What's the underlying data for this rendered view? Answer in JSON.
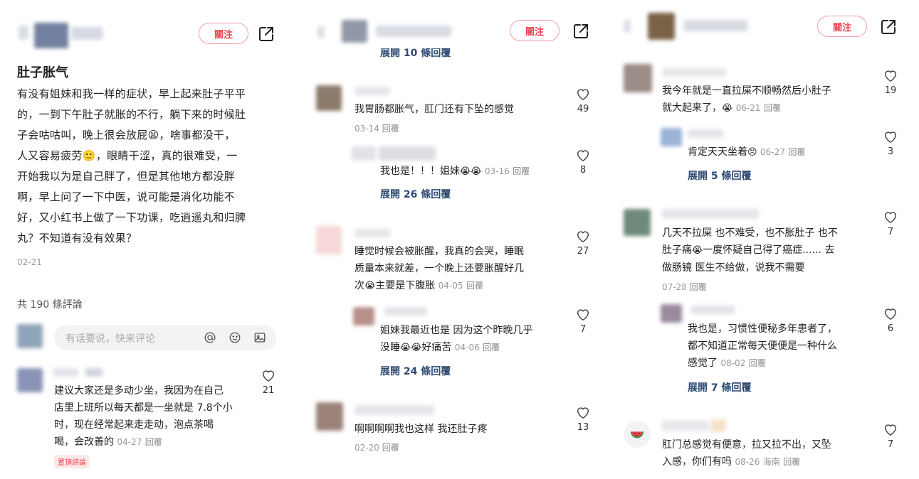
{
  "panel1": {
    "follow_label": "關注",
    "post_title": "肚子胀气",
    "post_lines": [
      "有没有姐妹和我一样的症状，早上起来肚子平平",
      "的，一到下午肚子就胀的不行，躺下来的时候肚",
      "子会咕咕叫，晚上很会放屁😫，啥事都没干，",
      "人又容易疲劳🙂，眼睛干涩，真的很难受，一",
      "开始我以为是自己胖了，但是其他地方都没胖",
      "啊，早上问了一下中医，说可能是消化功能不",
      "好，又小红书上做了一下功课，吃逍遥丸和归脾",
      "丸？不知道有没有效果？"
    ],
    "post_date": "02-21",
    "comment_count": "共 190 條評論",
    "input_placeholder": "有话要说，快来评论",
    "comment1": {
      "lines": [
        "建议大家还是多动少坐，我因为在自己",
        "店里上班所以每天都是一坐就是 7.8个小",
        "时，现在经常起来走走动，泡点茶喝"
      ],
      "last_line": "喝，会改善的",
      "date": "04-27",
      "reply": "回覆",
      "likes": "21",
      "pinned_label": "置頂評論"
    }
  },
  "panel2": {
    "follow_label": "關注",
    "top_cut": "展開 10 條回覆",
    "c1": {
      "text": "我胃肠都胀气，肛门还有下坠的感觉",
      "date": "03-14",
      "reply": "回覆",
      "likes": "49"
    },
    "r1": {
      "text": "我也是！！！姐妹",
      "emoji": "😭😭",
      "date": "03-16",
      "reply": "回覆",
      "likes": "8"
    },
    "expand1": "展開 26 條回覆",
    "c2": {
      "lines": [
        "睡觉时候会被胀醒，我真的会哭，睡眠",
        "质量本来就差，一个晚上还要胀醒好几"
      ],
      "last_prefix": "次",
      "emoji": "😭",
      "last_suffix": "主要是下腹胀",
      "date": "04-05",
      "reply": "回覆",
      "likes": "27"
    },
    "r2": {
      "line1": "姐妹我最近也是 因为这个昨晚几乎",
      "line2_prefix": "没睡",
      "emoji": "😭😭",
      "line2_suffix": "好痛苦",
      "date": "04-06",
      "reply": "回覆",
      "likes": "7"
    },
    "expand2": "展開 24 條回覆",
    "c3": {
      "text": "啊啊啊啊我也这样 我还肚子疼",
      "date": "02-20",
      "reply": "回覆",
      "likes": "13"
    }
  },
  "panel3": {
    "follow_label": "關注",
    "c1": {
      "line1": "我今年就是一直拉屎不顺畅然后小肚子",
      "line2_prefix": "就大起来了，",
      "emoji": "😭",
      "date": "06-21",
      "reply": "回覆",
      "likes": "19"
    },
    "r1": {
      "text": "肯定天天坐着",
      "emoji": "😣",
      "date": "06-27",
      "reply": "回覆",
      "likes": "3"
    },
    "expand1": "展開 5 條回覆",
    "c2": {
      "line1": "几天不拉屎 也不难受，也不胀肚子 也不",
      "line2_prefix": "肚子痛",
      "emoji": "😭",
      "line2_suffix": "一度怀疑自己得了癌症...... 去",
      "line3": "做肠镜 医生不给做，说我不需要",
      "date": "07-28",
      "reply": "回覆",
      "likes": "7"
    },
    "r2": {
      "lines": [
        "我也是，习惯性便秘多年患者了，",
        "都不知道正常每天便便是一种什么"
      ],
      "last_line": "感觉了",
      "date": "08-02",
      "reply": "回覆",
      "likes": "6"
    },
    "expand2": "展開 7 條回覆",
    "c3": {
      "line1": "肛门总感觉有便意，拉又拉不出，又坠",
      "line2": "入感，你们有吗",
      "date": "08-26",
      "location": "海南",
      "reply": "回覆",
      "likes": "7"
    }
  },
  "colors": {
    "accent": "#e8434f",
    "link": "#2e4a73"
  }
}
